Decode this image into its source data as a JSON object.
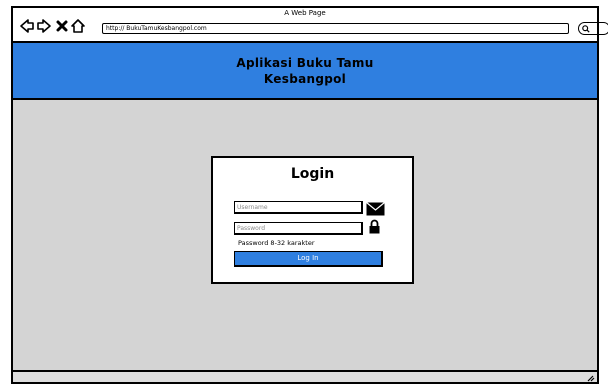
{
  "window": {
    "title": "A Web Page"
  },
  "browser": {
    "url": "http:// BukuTamuKesbangpol.com",
    "nav_icons": [
      "back-arrow-icon",
      "forward-arrow-icon",
      "close-icon",
      "home-icon"
    ],
    "search_icon": "search-icon"
  },
  "header": {
    "title_line1": "Aplikasi Buku Tamu",
    "title_line2": "Kesbangpol",
    "color": "#2f7fe0"
  },
  "login": {
    "title": "Login",
    "username_placeholder": "Username",
    "password_placeholder": "Password",
    "password_hint": "Password 8-32 karakter",
    "button_label": "Log In",
    "username_icon": "mail-icon",
    "password_icon": "lock-icon"
  },
  "colors": {
    "accent": "#2f7fe0",
    "content_bg": "#d4d4d4"
  }
}
